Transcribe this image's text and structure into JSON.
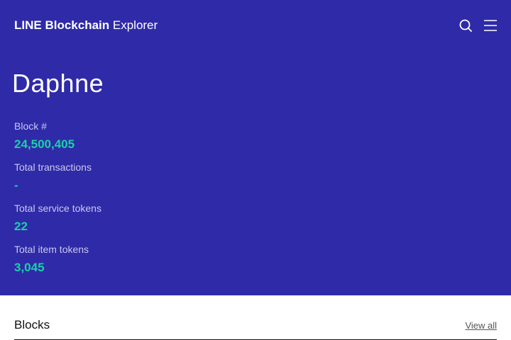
{
  "header": {
    "brand_strong": "LINE Blockchain",
    "brand_light": "Explorer",
    "search_icon": "search-icon",
    "menu_icon": "hamburger-menu-icon"
  },
  "network": {
    "name": "Daphne"
  },
  "stats": [
    {
      "label": "Block #",
      "value": "24,500,405"
    },
    {
      "label": "Total transactions",
      "value": "-"
    },
    {
      "label": "Total service tokens",
      "value": "22"
    },
    {
      "label": "Total item tokens",
      "value": "3,045"
    }
  ],
  "blocks_section": {
    "title": "Blocks",
    "view_all_label": "View all"
  },
  "colors": {
    "hero_background": "#2f2aa8",
    "accent_value": "#17d3a6",
    "label_muted": "#c9c8ee"
  }
}
